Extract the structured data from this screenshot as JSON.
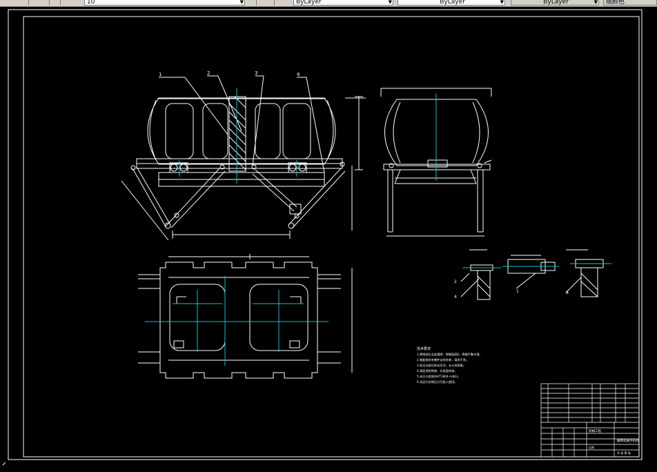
{
  "toolbar": {
    "textheight_value": "10",
    "layer_value": "ByLayer",
    "linetype_value": "ByLayer",
    "lineweight_value": "ByLayer",
    "plotstyle_value": "随颜色"
  },
  "colors": {
    "background": "#000000",
    "lines": "#ffffff",
    "centerlines": "#00c8d0",
    "toolbar": "#d4d0c8"
  },
  "drawing": {
    "balloons": [
      "1",
      "2",
      "3",
      "4"
    ],
    "detail_labels": [
      "2",
      "4",
      "1",
      "8"
    ],
    "notes_title": "技术要求",
    "notes_lines": [
      "1.焊接部位全部满焊，焊缝高度8，焊缝平整光滑。",
      "2.装配前所有零件去除毛刺，清洗干净。",
      "3.各活动部位转动灵活，无卡滞现象。",
      "4.表面涂防锈漆，外表面喷漆。",
      "5.未注公差按GB/T1804-m执行。",
      "6.试运行合格后方可投入使用。"
    ]
  },
  "title_block": {
    "drawing_name": "翻转机械手机构",
    "company": "机械工程",
    "scale_label": "比例",
    "sheet_label": "共 张 第 张"
  }
}
